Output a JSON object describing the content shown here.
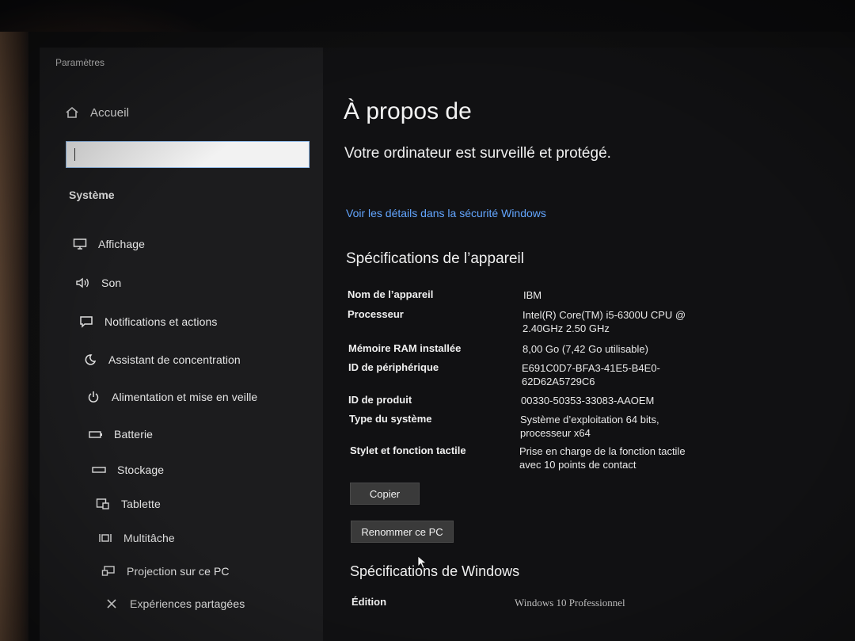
{
  "app": {
    "title": "Paramètres"
  },
  "sidebar": {
    "home_label": "Accueil",
    "search_value": "",
    "section_label": "Système",
    "items": [
      {
        "label": "Affichage",
        "icon": "monitor-icon"
      },
      {
        "label": "Son",
        "icon": "speaker-icon"
      },
      {
        "label": "Notifications et actions",
        "icon": "notification-icon"
      },
      {
        "label": "Assistant de concentration",
        "icon": "moon-icon"
      },
      {
        "label": "Alimentation et mise en veille",
        "icon": "power-icon"
      },
      {
        "label": "Batterie",
        "icon": "battery-icon"
      },
      {
        "label": "Stockage",
        "icon": "storage-icon"
      },
      {
        "label": "Tablette",
        "icon": "tablet-icon"
      },
      {
        "label": "Multitâche",
        "icon": "multitask-icon"
      },
      {
        "label": "Projection sur ce PC",
        "icon": "projection-icon"
      },
      {
        "label": "Expériences partagées",
        "icon": "shared-experiences-icon"
      }
    ]
  },
  "main": {
    "title": "À propos de",
    "status": "Votre ordinateur est surveillé et protégé.",
    "security_link": "Voir les détails dans la sécurité Windows",
    "device_specs_heading": "Spécifications de l’appareil",
    "device_specs": [
      {
        "label": "Nom de l’appareil",
        "value": "IBM"
      },
      {
        "label": "Processeur",
        "value": "Intel(R) Core(TM) i5-6300U CPU @ 2.40GHz   2.50 GHz"
      },
      {
        "label": "Mémoire RAM installée",
        "value": "8,00 Go (7,42 Go utilisable)"
      },
      {
        "label": "ID de périphérique",
        "value": "E691C0D7-BFA3-41E5-B4E0-62D62A5729C6"
      },
      {
        "label": "ID de produit",
        "value": "00330-50353-33083-AAOEM"
      },
      {
        "label": "Type du système",
        "value": "Système d’exploitation 64 bits, processeur x64"
      },
      {
        "label": "Stylet et fonction tactile",
        "value": "Prise en charge de la fonction tactile avec 10 points de contact"
      }
    ],
    "copy_button": "Copier",
    "rename_button": "Renommer ce PC",
    "windows_specs_heading": "Spécifications de Windows",
    "windows_specs": [
      {
        "label": "Édition",
        "value": "Windows 10 Professionnel"
      }
    ]
  },
  "colors": {
    "accent_link": "#63a6ff",
    "sidebar_bg": "#1c1c1e",
    "main_bg": "#111113"
  }
}
